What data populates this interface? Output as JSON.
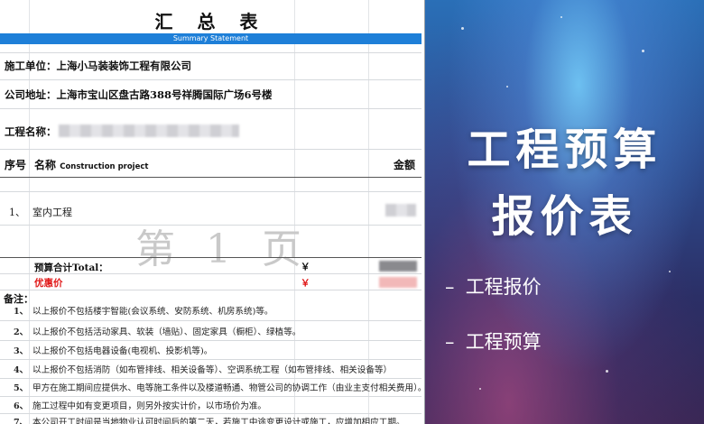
{
  "sheet": {
    "title": "汇 总 表",
    "subtitle": "Summary Statement",
    "company_label": "施工单位：上海小马装装饰工程有限公司",
    "address_label": "公司地址：上海市宝山区盘古路388号祥腾国际广场6号楼",
    "project_label": "工程名称：",
    "header": {
      "seq": "序号",
      "name": "名称",
      "name_en": "Construction project",
      "amount": "金额"
    },
    "item": {
      "seq": "1、",
      "name": "室内工程"
    },
    "page_watermark": "第 1 页",
    "total_label": "预算合计Total：",
    "discount_label": "优惠价",
    "currency": "￥",
    "notes_title": "备注：",
    "notes": [
      {
        "num": "1、",
        "text": "以上报价不包括楼宇智能(会议系统、安防系统、机房系统)等。"
      },
      {
        "num": "2、",
        "text": "以上报价不包括活动家具、软装（墙贴）、固定家具（橱柜）、绿植等。"
      },
      {
        "num": "3、",
        "text": "以上报价不包括电器设备(电视机、投影机等)。"
      },
      {
        "num": "4、",
        "text": "以上报价不包括消防（如布管排线、相关设备等）、空调系统工程（如布管排线、相关设备等）"
      },
      {
        "num": "5、",
        "text": "甲方在施工期间应提供水、电等施工条件以及楼道畅通、物管公司的协调工作（由业主支付相关费用）。"
      },
      {
        "num": "6、",
        "text": "施工过程中如有变更项目，则另外按实计价，以市场价为准。"
      },
      {
        "num": "7、",
        "text": "本公司开工时间是当地物业认可时间后的第二天，若施工中途变更设计或施工，应增加相应工期。"
      }
    ]
  },
  "promo": {
    "title_line1": "工程预算",
    "title_line2": "报价表",
    "bullets": [
      "工程报价",
      "工程预算"
    ],
    "dash": "–"
  },
  "colors": {
    "band": "#1e7fd8",
    "discount": "#e01818"
  }
}
